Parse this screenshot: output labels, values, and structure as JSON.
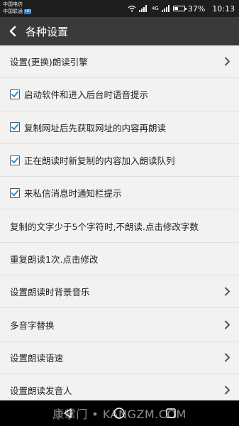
{
  "status": {
    "carrier1": "中国电信",
    "carrier2": "中国联通",
    "hd": "HD",
    "signal": "4G",
    "battery_pct": "37%",
    "battery_level": 0.37,
    "time": "10:13"
  },
  "appbar": {
    "title": "各种设置"
  },
  "items": [
    {
      "label": "设置(更换)朗读引擎",
      "checkbox": false,
      "chevron": true
    },
    {
      "label": "启动软件和进入后台时语音提示",
      "checkbox": true,
      "checked": true,
      "chevron": false
    },
    {
      "label": "复制网址后先获取网址的内容再朗读",
      "checkbox": true,
      "checked": true,
      "chevron": false
    },
    {
      "label": "正在朗读时新复制的内容加入朗读队列",
      "checkbox": true,
      "checked": true,
      "chevron": false
    },
    {
      "label": "来私信消息时通知栏提示",
      "checkbox": true,
      "checked": true,
      "chevron": false
    },
    {
      "label": "复制的文字少于5个字符时,不朗读.点击修改字数",
      "checkbox": false,
      "chevron": false
    },
    {
      "label": "重复朗读1次.点击修改",
      "checkbox": false,
      "chevron": false
    },
    {
      "label": "设置朗读时背景音乐",
      "checkbox": false,
      "chevron": true
    },
    {
      "label": "多音字替换",
      "checkbox": false,
      "chevron": true
    },
    {
      "label": "设置朗读语速",
      "checkbox": false,
      "chevron": true
    },
    {
      "label": "设置朗读发音人",
      "checkbox": false,
      "chevron": true
    }
  ],
  "watermark": "康掌门 • KANGZM.COM",
  "colors": {
    "appbar": "#3a3a3a",
    "statusbar": "#1e1e1e",
    "background": "#f2f2f2",
    "checkbox_check": "#2a8fd6"
  }
}
